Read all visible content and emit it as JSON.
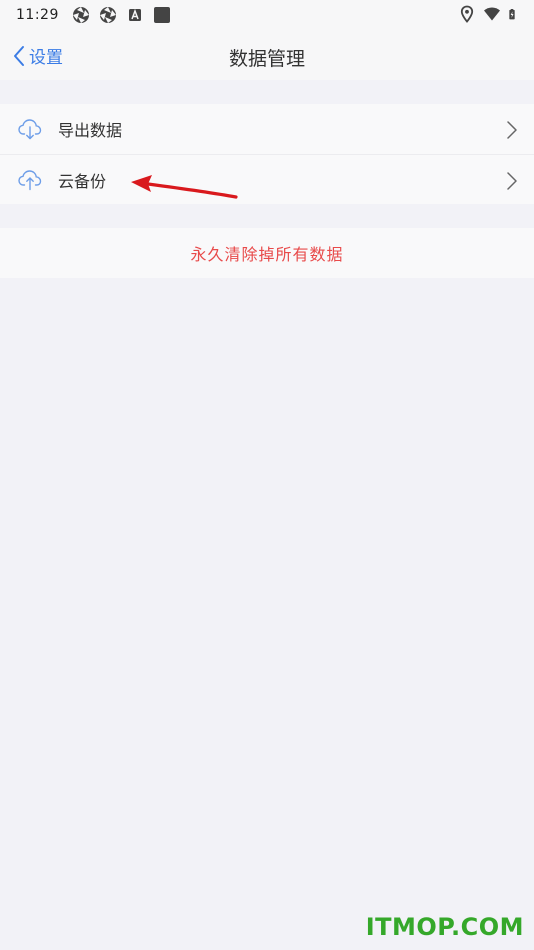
{
  "status_bar": {
    "time": "11:29",
    "left_icons": [
      "aperture-icon",
      "aperture-icon",
      "a-badge-icon",
      "square-icon"
    ],
    "right_icons": [
      "location-pin-icon",
      "wifi-icon",
      "battery-charging-icon"
    ]
  },
  "nav": {
    "back_label": "设置",
    "title": "数据管理"
  },
  "group_1": {
    "items": [
      {
        "label": "导出数据",
        "icon": "cloud-download-icon"
      },
      {
        "label": "云备份",
        "icon": "cloud-upload-icon"
      }
    ]
  },
  "group_2": {
    "danger_label": "永久清除掉所有数据"
  },
  "watermark": "ITMOP.COM",
  "colors": {
    "accent": "#3b7ce5",
    "danger": "#e84a4a",
    "background": "#f2f2f7",
    "annotation_arrow": "#d9191d",
    "watermark": "#35a82a"
  }
}
